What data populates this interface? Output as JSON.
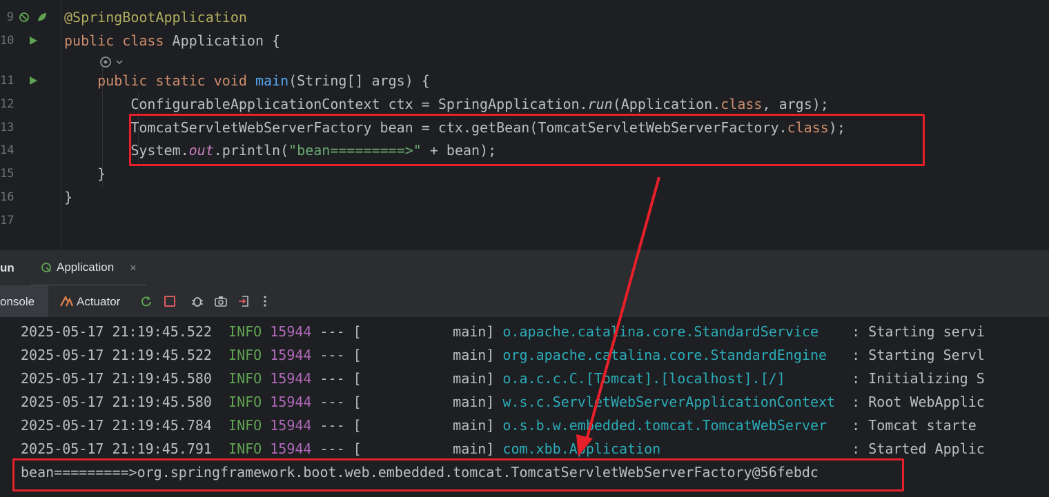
{
  "editor": {
    "lines": [
      {
        "num": "9",
        "parts": [
          {
            "t": "@SpringBootApplication",
            "c": "ann"
          }
        ]
      },
      {
        "num": "10",
        "parts": [
          {
            "t": "public class ",
            "c": "kw"
          },
          {
            "t": "Application {",
            "c": ""
          }
        ]
      },
      {
        "num": "11",
        "parts": [
          {
            "t": "    "
          },
          {
            "t": "public static void ",
            "c": "kw"
          },
          {
            "t": "main",
            "c": "fn"
          },
          {
            "t": "(String[] args) {",
            "c": ""
          }
        ]
      },
      {
        "num": "12",
        "parts": [
          {
            "t": "        ConfigurableApplicationContext ctx = SpringApplication."
          },
          {
            "t": "run",
            "c": "it"
          },
          {
            "t": "(Application."
          },
          {
            "t": "class",
            "c": "kw"
          },
          {
            "t": ", args);",
            "c": ""
          }
        ]
      },
      {
        "num": "13",
        "parts": [
          {
            "t": "        TomcatServletWebServerFactory bean = ctx.getBean(TomcatServletWebServerFactory."
          },
          {
            "t": "class",
            "c": "kw"
          },
          {
            "t": ");",
            "c": ""
          }
        ]
      },
      {
        "num": "14",
        "parts": [
          {
            "t": "        System."
          },
          {
            "t": "out",
            "c": "fld"
          },
          {
            "t": ".println("
          },
          {
            "t": "\"bean=========>\"",
            "c": "str"
          },
          {
            "t": " + bean);",
            "c": ""
          }
        ]
      },
      {
        "num": "15",
        "parts": [
          {
            "t": "    }"
          }
        ]
      },
      {
        "num": "16",
        "parts": [
          {
            "t": "}"
          }
        ]
      },
      {
        "num": "17",
        "parts": []
      }
    ]
  },
  "run_panel": {
    "run_label": "un",
    "tab_label": "Application",
    "tab_close": "×",
    "console_label": "onsole",
    "actuator_label": "Actuator"
  },
  "console": {
    "logs": [
      {
        "ts": "2025-05-17 21:19:45.522",
        "level": "INFO",
        "pid": "15944",
        "sep": " --- [",
        "thread": "           main]",
        "logger": "o.apache.catalina.core.StandardService   ",
        "msg": ": Starting servi"
      },
      {
        "ts": "2025-05-17 21:19:45.522",
        "level": "INFO",
        "pid": "15944",
        "sep": " --- [",
        "thread": "           main]",
        "logger": "org.apache.catalina.core.StandardEngine  ",
        "msg": ": Starting Servl"
      },
      {
        "ts": "2025-05-17 21:19:45.580",
        "level": "INFO",
        "pid": "15944",
        "sep": " --- [",
        "thread": "           main]",
        "logger": "o.a.c.c.C.[Tomcat].[localhost].[/]       ",
        "msg": ": Initializing S"
      },
      {
        "ts": "2025-05-17 21:19:45.580",
        "level": "INFO",
        "pid": "15944",
        "sep": " --- [",
        "thread": "           main]",
        "logger": "w.s.c.ServletWebServerApplicationContext ",
        "msg": ": Root WebApplic"
      },
      {
        "ts": "2025-05-17 21:19:45.784",
        "level": "INFO",
        "pid": "15944",
        "sep": " --- [",
        "thread": "           main]",
        "logger": "o.s.b.w.embedded.tomcat.TomcatWebServer  ",
        "msg": ": Tomcat starte"
      },
      {
        "ts": "2025-05-17 21:19:45.791",
        "level": "INFO",
        "pid": "15944",
        "sep": " --- [",
        "thread": "           main]",
        "logger": "com.xbb.Application                      ",
        "msg": ": Started Applic"
      }
    ],
    "output_line": "bean=========>org.springframework.boot.web.embedded.tomcat.TomcatServletWebServerFactory@56febdc"
  },
  "colors": {
    "highlight_box": "#e8202a",
    "arrow": "#e8202a"
  }
}
